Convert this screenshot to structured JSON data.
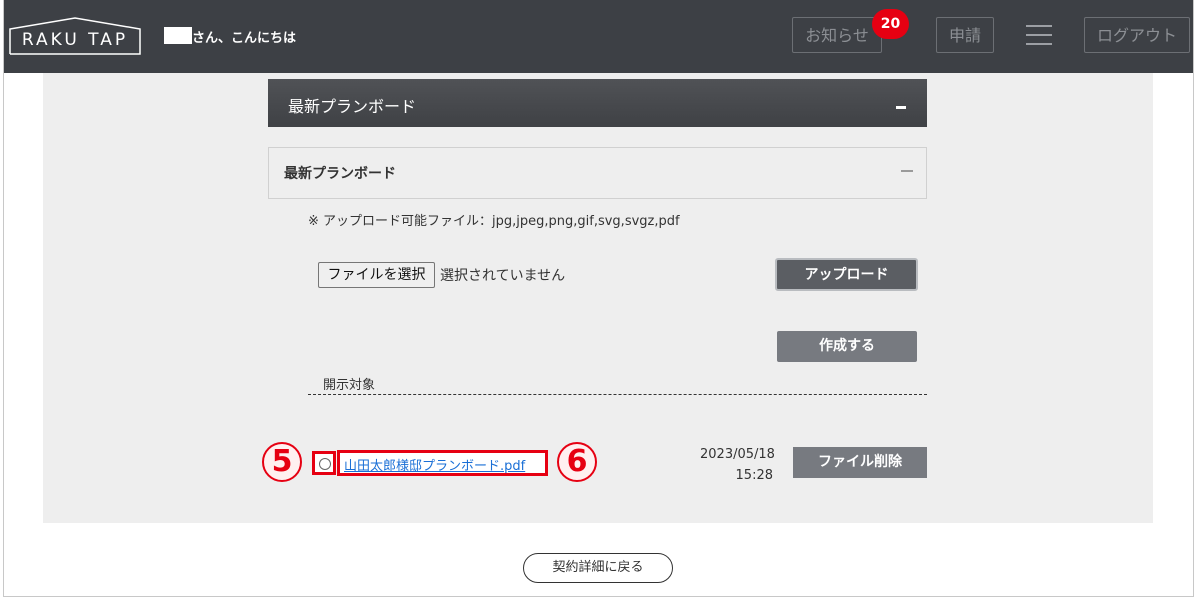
{
  "header": {
    "logo_text": "RAKU TAP",
    "greeting": "さん、こんにちは",
    "notice_label": "お知らせ",
    "notice_count": "20",
    "apply_label": "申請",
    "logout_label": "ログアウト",
    "menu_icon": "hamburger-icon"
  },
  "section": {
    "title": "最新プランボード",
    "sub_title": "最新プランボード",
    "upload_note": "※ アップロード可能ファイル：jpg,jpeg,png,gif,svg,svgz,pdf",
    "choose_file_label": "ファイルを選択",
    "file_status": "選択されていません",
    "upload_label": "アップロード",
    "create_label": "作成する",
    "target_label": "開示対象"
  },
  "files": [
    {
      "name": "山田太郎様邸プランボード.pdf",
      "date": "2023/05/18",
      "time": "15:28",
      "delete_label": "ファイル削除"
    }
  ],
  "annotations": {
    "marker_checkbox": "5",
    "marker_link": "6",
    "color": "#e60012"
  },
  "footer": {
    "back_label": "契約詳細に戻る"
  },
  "colors": {
    "header_bg": "#3d4045",
    "badge": "#e60012",
    "link": "#1a6fd6"
  }
}
